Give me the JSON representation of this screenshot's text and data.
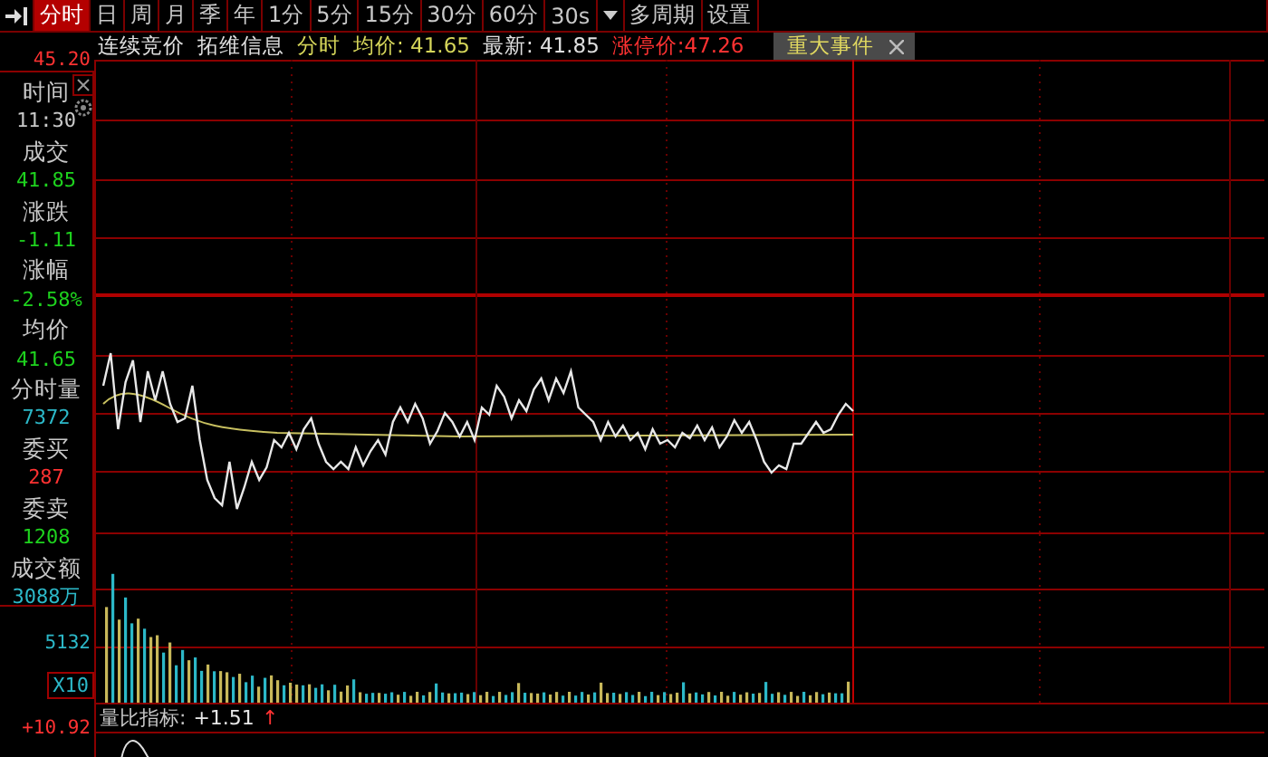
{
  "toolbar": {
    "periods": [
      {
        "label": "分时",
        "selected": true
      },
      {
        "label": "日",
        "selected": false
      },
      {
        "label": "周",
        "selected": false
      },
      {
        "label": "月",
        "selected": false
      },
      {
        "label": "季",
        "selected": false
      },
      {
        "label": "年",
        "selected": false
      },
      {
        "label": "1分",
        "selected": false
      },
      {
        "label": "5分",
        "selected": false
      },
      {
        "label": "15分",
        "selected": false
      },
      {
        "label": "30分",
        "selected": false
      },
      {
        "label": "60分",
        "selected": false
      },
      {
        "label": "30s",
        "selected": false
      }
    ],
    "extra_buttons": [
      "多周期",
      "设置"
    ]
  },
  "info_bar": {
    "items": [
      {
        "text": "连续竞价",
        "kind": "plain"
      },
      {
        "text": "拓维信息",
        "kind": "plain"
      },
      {
        "text": "分时",
        "kind": "average"
      },
      {
        "text": "均价: 41.65",
        "kind": "average"
      },
      {
        "text": "最新: 41.85",
        "kind": "plain"
      },
      {
        "text": "涨停价:47.26",
        "kind": "limit"
      }
    ],
    "event_tab": {
      "label": "重大事件"
    }
  },
  "side_panel": {
    "price_tick": "45.20",
    "fields": [
      {
        "label": "时间",
        "value": "11:30",
        "color": "#c8c8c8"
      },
      {
        "label": "成交",
        "value": "41.85",
        "color": "#1ed21e"
      },
      {
        "label": "涨跌",
        "value": "-1.11",
        "color": "#1ed21e"
      },
      {
        "label": "涨幅",
        "value": "-2.58%",
        "color": "#1ed21e"
      },
      {
        "label": "均价",
        "value": "41.65",
        "color": "#1ed21e"
      },
      {
        "label": "分时量",
        "value": "7372",
        "color": "#2cb8c8"
      },
      {
        "label": "委买",
        "value": "287",
        "color": "#ff3232"
      },
      {
        "label": "委卖",
        "value": "1208",
        "color": "#1ed21e"
      },
      {
        "label": "成交额",
        "value": "3088万",
        "color": "#2cb8c8"
      }
    ],
    "volume_tick": "5132",
    "scale": "X10",
    "bottom_tick": "+10.92"
  },
  "indicator": {
    "label": "量比指标:",
    "value": "+1.51",
    "trend": "↑"
  }
}
